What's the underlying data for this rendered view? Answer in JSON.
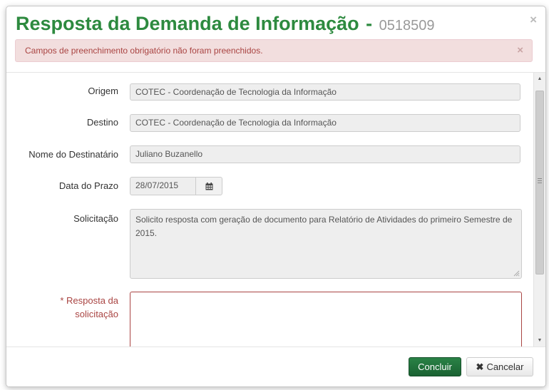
{
  "modal": {
    "title": "Resposta da Demanda de Informação",
    "title_separator": "-",
    "demand_code": "0518509",
    "close_glyph": "×"
  },
  "alert": {
    "message": "Campos de preenchimento obrigatório não foram preenchidos.",
    "close_glyph": "×"
  },
  "form": {
    "origem": {
      "label": "Origem",
      "value": "COTEC - Coordenação de Tecnologia da Informação"
    },
    "destino": {
      "label": "Destino",
      "value": "COTEC - Coordenação de Tecnologia da Informação"
    },
    "destinatario": {
      "label": "Nome do Destinatário",
      "value": "Juliano Buzanello"
    },
    "prazo": {
      "label": "Data do Prazo",
      "value": "28/07/2015",
      "icon": "calendar-icon"
    },
    "solicitacao": {
      "label": "Solicitação",
      "value": "Solicito resposta com geração de documento para Relatório de Atividades do primeiro Semestre de 2015."
    },
    "resposta": {
      "label_line1": "* Resposta da",
      "label_line2": "solicitação",
      "value": "",
      "required": true
    }
  },
  "footer": {
    "concluir_label": "Concluir",
    "cancelar_label": "Cancelar",
    "cancelar_icon_glyph": "✖"
  },
  "colors": {
    "title_green": "#2d8a3f",
    "alert_bg": "#f2dede",
    "alert_text": "#a94442",
    "primary_button": "#1e6e3a"
  }
}
